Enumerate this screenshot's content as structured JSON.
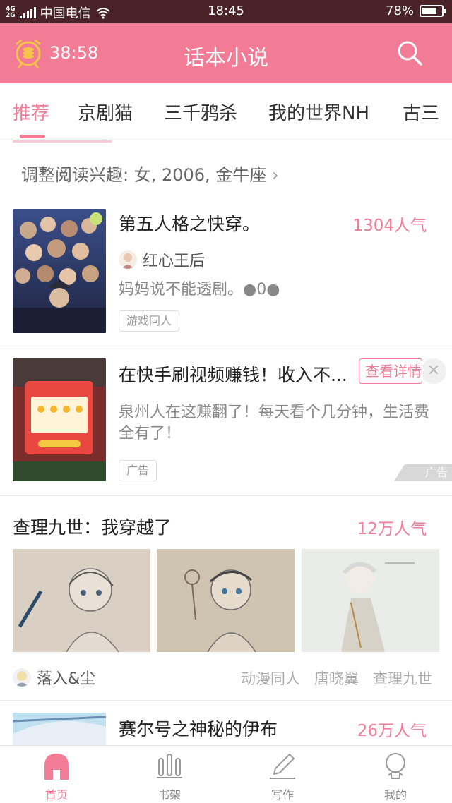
{
  "status_bar": {
    "network": "4G\n2G",
    "carrier": "中国电信",
    "time": "18:45",
    "battery": "78%",
    "battery_level": 0.78
  },
  "header": {
    "timer": "38:58",
    "title": "话本小说",
    "icons": [
      "alarm-clock-icon",
      "search-icon"
    ]
  },
  "tabs": {
    "items": [
      "推荐",
      "京剧猫",
      "三千鸦杀",
      "我的世界NH",
      "古三"
    ],
    "active_index": 0
  },
  "feed": {
    "interest": "调整阅读兴趣: 女, 2006, 金牛座",
    "novel1": {
      "title": "第五人格之快穿。",
      "popularity": "1304人气",
      "author": "红心王后",
      "desc": "妈妈说不能透剧。●0●",
      "tag": "游戏同人"
    },
    "ad": {
      "title": "在快手刷视频赚钱！收入不...",
      "detail": "查看详情",
      "desc": "泉州人在这赚翻了！每天看个几分钟，生活费全有了！",
      "tag": "广告",
      "mark": "广告",
      "close": "✕"
    },
    "novel2": {
      "title": "查理九世：我穿越了",
      "popularity": "12万人气",
      "author": "落入&尘",
      "tags": [
        "动漫同人",
        "唐晓翼",
        "查理九世"
      ]
    },
    "novel3": {
      "title": "赛尔号之神秘的伊布",
      "popularity": "26万人气"
    }
  },
  "bottom_nav": {
    "items": [
      "首页",
      "书架",
      "写作",
      "我的"
    ],
    "active_index": 0
  },
  "colors": {
    "accent": "#f27b96",
    "status_bar": "#4a2328"
  }
}
